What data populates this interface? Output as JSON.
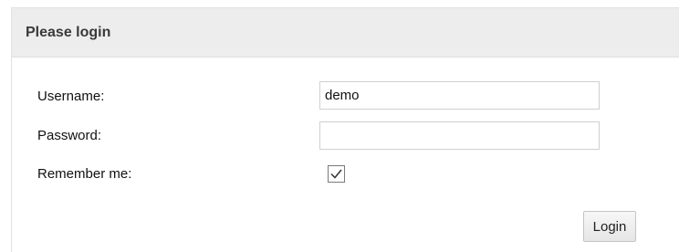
{
  "panel": {
    "title": "Please login"
  },
  "form": {
    "username_label": "Username:",
    "username_value": "demo",
    "password_label": "Password:",
    "password_value": "",
    "remember_label": "Remember me:",
    "remember_checked": true,
    "login_label": "Login"
  }
}
